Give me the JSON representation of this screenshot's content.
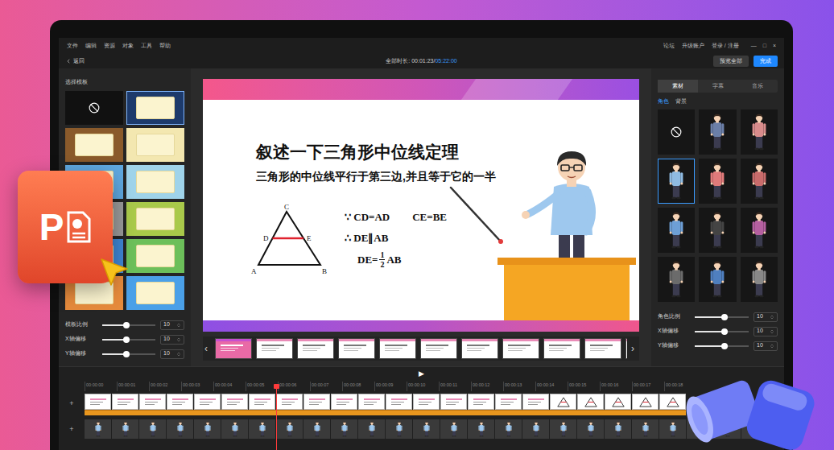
{
  "menu": [
    "文件",
    "编辑",
    "资源",
    "对象",
    "工具",
    "帮助"
  ],
  "account_links": [
    "论坛",
    "升级账户",
    "登录 / 注册"
  ],
  "window_controls": [
    "—",
    "□",
    "×"
  ],
  "back": "返回",
  "duration": {
    "label": "全部时长: ",
    "current": "00:01:23",
    "separator": "/",
    "total": "05:22:00"
  },
  "actions": [
    {
      "label": "预览全部",
      "primary": false
    },
    {
      "label": "完成",
      "primary": true
    }
  ],
  "template_panel": {
    "title": "选择模板",
    "templates": [
      {
        "kind": "none",
        "color": "#111111",
        "selected": false
      },
      {
        "kind": "board",
        "color": "#1d3a6b",
        "selected": true
      },
      {
        "kind": "board",
        "color": "#8a5a2b",
        "selected": false
      },
      {
        "kind": "board",
        "color": "#f3e7b0",
        "selected": false
      },
      {
        "kind": "board",
        "color": "#5fa8e0",
        "selected": false
      },
      {
        "kind": "board",
        "color": "#9fd3ea",
        "selected": false
      },
      {
        "kind": "board",
        "color": "#9a9a9a",
        "selected": false
      },
      {
        "kind": "board",
        "color": "#a9c94a",
        "selected": false
      },
      {
        "kind": "board",
        "color": "#3f86d4",
        "selected": false
      },
      {
        "kind": "board",
        "color": "#6cbf5a",
        "selected": false
      },
      {
        "kind": "board",
        "color": "#e58a3c",
        "selected": false
      },
      {
        "kind": "board",
        "color": "#4aa0e8",
        "selected": false
      }
    ],
    "sliders": [
      {
        "label": "模板比例",
        "value": "10",
        "level": 0.45
      },
      {
        "label": "X轴偏移",
        "value": "10",
        "level": 0.45
      },
      {
        "label": "Y轴偏移",
        "value": "10",
        "level": 0.45
      }
    ]
  },
  "slide": {
    "title": "叙述一下三角形中位线定理",
    "subtitle": "三角形的中位线平行于第三边,并且等于它的一半",
    "triangle_labels": {
      "top": "C",
      "left_mid": "D",
      "right_mid": "E",
      "left": "A",
      "right": "B"
    },
    "proof": {
      "given": "∵ CD=AD",
      "given2": "CE=BE",
      "therefore": "∴ DE∥AB",
      "result_left": "DE=",
      "numerator": "1",
      "denominator": "2",
      "result_right": "AB"
    }
  },
  "thumbnails": {
    "prev": "‹",
    "next": "›",
    "items": [
      {
        "kind": "title",
        "selected": false
      },
      {
        "kind": "content",
        "selected": false
      },
      {
        "kind": "content",
        "selected": false
      },
      {
        "kind": "content",
        "selected": false
      },
      {
        "kind": "content",
        "selected": false
      },
      {
        "kind": "content",
        "selected": false
      },
      {
        "kind": "content",
        "selected": false
      },
      {
        "kind": "content",
        "selected": false
      },
      {
        "kind": "content",
        "selected": false
      },
      {
        "kind": "content",
        "selected": false
      },
      {
        "kind": "content",
        "selected": false
      }
    ]
  },
  "asset_panel": {
    "tabs": [
      {
        "label": "素材",
        "selected": true
      },
      {
        "label": "字幕",
        "selected": false
      },
      {
        "label": "音乐",
        "selected": false
      }
    ],
    "subtabs": [
      {
        "label": "角色",
        "selected": true
      },
      {
        "label": "背景",
        "selected": false
      }
    ],
    "characters": [
      {
        "kind": "none",
        "color": "#111111",
        "selected": false
      },
      {
        "kind": "character",
        "color": "#6b7fa8",
        "selected": false
      },
      {
        "kind": "character",
        "color": "#d98c8c",
        "selected": false
      },
      {
        "kind": "character",
        "color": "#8fbbe3",
        "selected": true
      },
      {
        "kind": "character",
        "color": "#e07a7a",
        "selected": false
      },
      {
        "kind": "character",
        "color": "#c96b6b",
        "selected": false
      },
      {
        "kind": "character",
        "color": "#6d9fd6",
        "selected": false
      },
      {
        "kind": "character",
        "color": "#444444",
        "selected": false
      },
      {
        "kind": "character",
        "color": "#b55fa0",
        "selected": false
      },
      {
        "kind": "character",
        "color": "#6b6b6b",
        "selected": false
      },
      {
        "kind": "character",
        "color": "#4f7fbf",
        "selected": false
      },
      {
        "kind": "character",
        "color": "#888888",
        "selected": false
      }
    ],
    "sliders": [
      {
        "label": "角色比例",
        "value": "10",
        "level": 0.55
      },
      {
        "label": "X轴偏移",
        "value": "10",
        "level": 0.55
      },
      {
        "label": "Y轴偏移",
        "value": "10",
        "level": 0.55
      }
    ]
  },
  "timeline": {
    "play": "▶",
    "ticks": [
      "00:00:00",
      "00:00:01",
      "00:00:02",
      "00:00:03",
      "00:00:04",
      "00:00:05",
      "00:00:06",
      "00:00:07",
      "00:00:08",
      "00:00:09",
      "00:00:10",
      "00:00:11",
      "00:00:12",
      "00:00:13",
      "00:00:14",
      "00:00:15",
      "00:00:16",
      "00:00:17",
      "00:00:18"
    ],
    "playhead": 0.33,
    "add_buttons": [
      "+",
      "+"
    ],
    "slide_clips": [
      {
        "kind": "slide"
      },
      {
        "kind": "slide"
      },
      {
        "kind": "slide"
      },
      {
        "kind": "slide"
      },
      {
        "kind": "slide"
      },
      {
        "kind": "slide"
      },
      {
        "kind": "slide"
      },
      {
        "kind": "slide"
      },
      {
        "kind": "slide"
      },
      {
        "kind": "slide"
      },
      {
        "kind": "slide"
      },
      {
        "kind": "slide"
      },
      {
        "kind": "slide"
      },
      {
        "kind": "slide"
      },
      {
        "kind": "slide"
      },
      {
        "kind": "slide"
      },
      {
        "kind": "slide"
      },
      {
        "kind": "triangle"
      },
      {
        "kind": "triangle"
      },
      {
        "kind": "triangle"
      },
      {
        "kind": "triangle"
      },
      {
        "kind": "triangle"
      }
    ],
    "character_clips": [
      {
        "kind": "teacher"
      },
      {
        "kind": "teacher"
      },
      {
        "kind": "teacher"
      },
      {
        "kind": "teacher"
      },
      {
        "kind": "teacher"
      },
      {
        "kind": "teacher"
      },
      {
        "kind": "teacher"
      },
      {
        "kind": "teacher"
      },
      {
        "kind": "teacher"
      },
      {
        "kind": "teacher"
      },
      {
        "kind": "teacher"
      },
      {
        "kind": "teacher"
      },
      {
        "kind": "teacher"
      },
      {
        "kind": "teacher"
      },
      {
        "kind": "teacher"
      },
      {
        "kind": "teacher"
      },
      {
        "kind": "teacher"
      },
      {
        "kind": "teacher"
      },
      {
        "kind": "teacher"
      },
      {
        "kind": "teacher"
      },
      {
        "kind": "teacher"
      },
      {
        "kind": "teacher"
      },
      {
        "kind": "teacher"
      },
      {
        "kind": "teacher"
      },
      {
        "kind": "teacher"
      }
    ]
  },
  "overlay": {
    "powerpoint_letter": "P"
  }
}
